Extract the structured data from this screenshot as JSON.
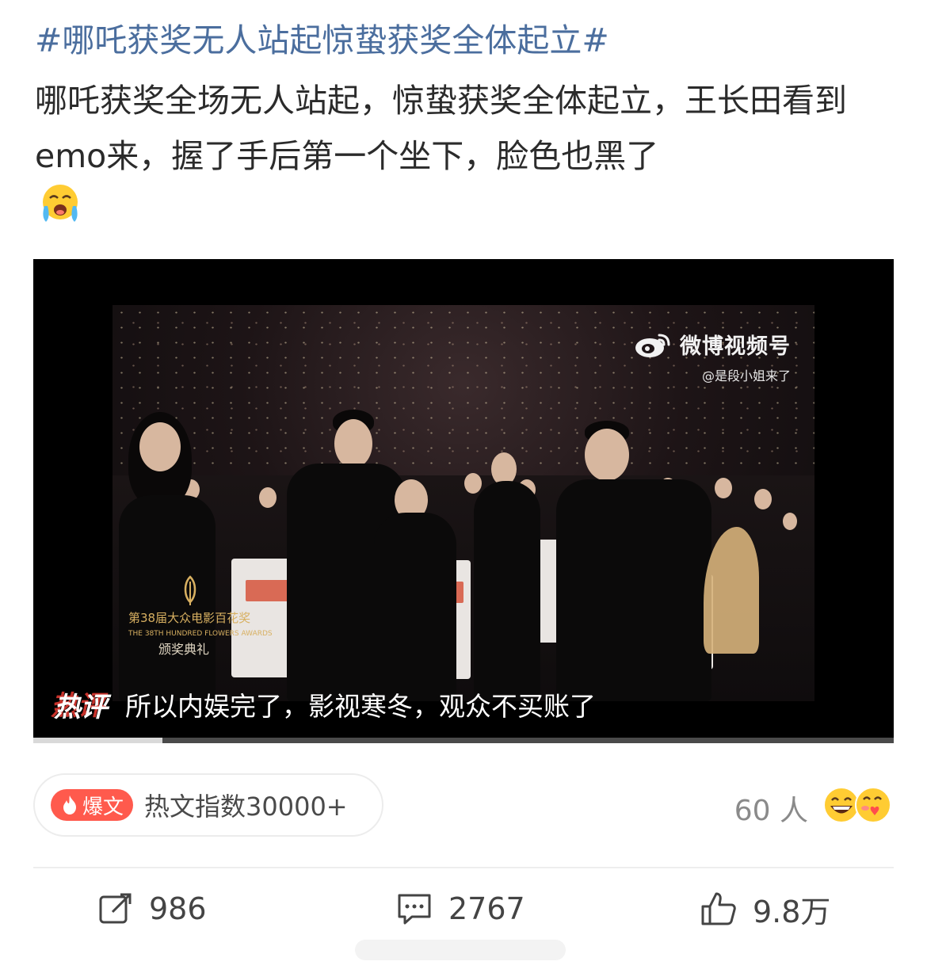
{
  "post": {
    "hashtag": "#哪吒获奖无人站起惊蛰获奖全体起立#",
    "text": "哪吒获奖全场无人站起，惊蛰获奖全体起立，王长田看到emo来，握了手后第一个坐下，脸色也黑了",
    "trailing_emoji": "crying-face-emoji"
  },
  "video": {
    "watermark_title": "微博视频号",
    "watermark_handle": "@是段小姐来了",
    "event_logo_line1": "第38届大众电影百花奖",
    "event_logo_line2": "THE 38TH HUNDRED FLOWERS AWARDS",
    "event_logo_line3": "颁奖典礼",
    "caption_tag": "热评",
    "caption_text": "所以内娱完了，影视寒冬，观众不买账了",
    "progress": 0.15
  },
  "hot_article": {
    "badge_label": "爆文",
    "index_label": "热文指数30000+"
  },
  "reactions": {
    "count_label": "60 人",
    "emojis": [
      "grinning-face-emoji",
      "kissing-heart-face-emoji"
    ]
  },
  "actions": {
    "repost_count": "986",
    "comment_count": "2767",
    "like_count": "9.8万"
  },
  "colors": {
    "hashtag": "#4b6e9e",
    "badge": "#ff5a4d",
    "caption_accent": "#c7322b"
  }
}
